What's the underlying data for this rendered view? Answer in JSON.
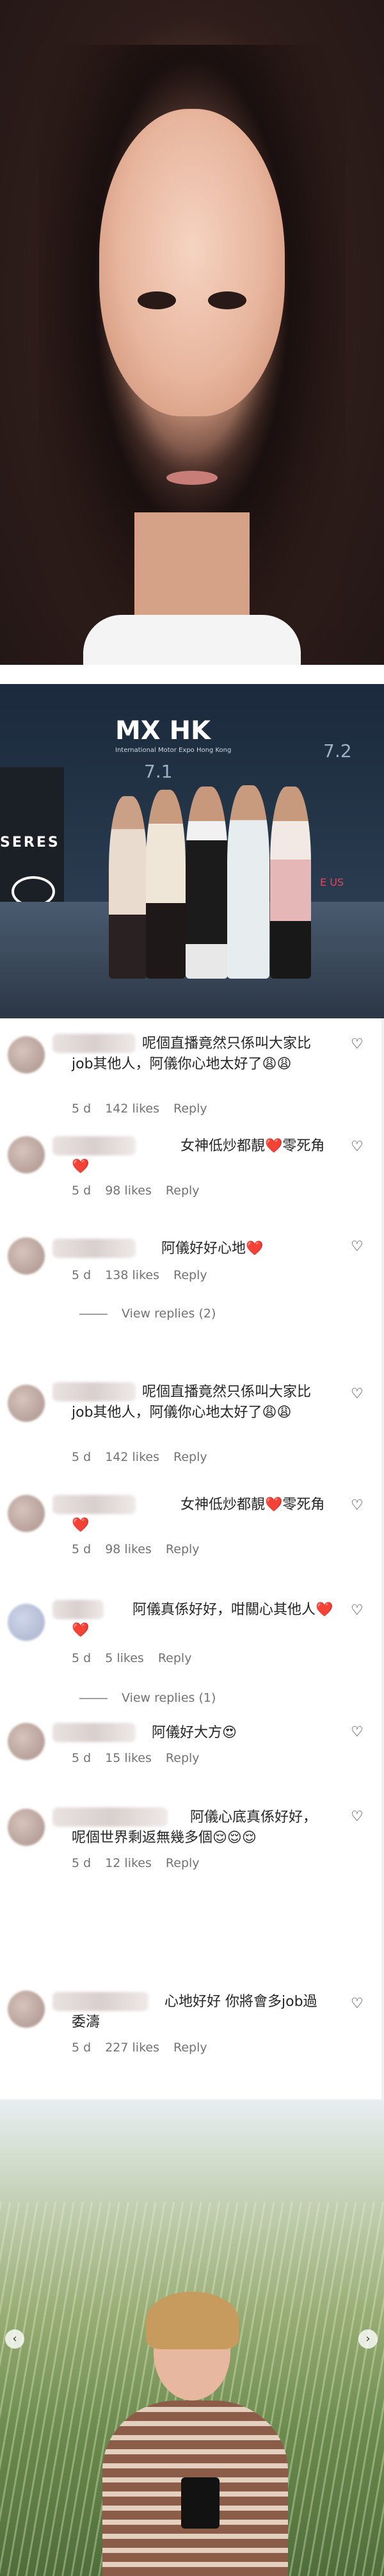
{
  "event_photo": {
    "logo": "MX HK",
    "logo_sub": "International Motor Expo Hong Kong",
    "booth_num_1": "7.1",
    "booth_num_2": "7.2",
    "brand_text": "SERES",
    "brand_tail": "E US"
  },
  "comments": [
    {
      "text": "呢個直播竟然只係叫大家比job其他人，阿儀你心地太好了😩😩",
      "time": "5 d",
      "likes": "142 likes",
      "reply": "Reply"
    },
    {
      "text": "女神低炒都靚❤️零死角❤️",
      "time": "5 d",
      "likes": "98 likes",
      "reply": "Reply"
    },
    {
      "text": "阿儀好好心地❤️",
      "time": "5 d",
      "likes": "138 likes",
      "reply": "Reply",
      "view_replies": "View replies (2)"
    },
    {
      "text": "呢個直播竟然只係叫大家比job其他人，阿儀你心地太好了😩😩",
      "time": "5 d",
      "likes": "142 likes",
      "reply": "Reply"
    },
    {
      "text": "女神低炒都靚❤️零死角❤️",
      "time": "5 d",
      "likes": "98 likes",
      "reply": "Reply"
    },
    {
      "text": "阿儀真係好好，咁關心其他人❤️❤️",
      "time": "5 d",
      "likes": "5 likes",
      "reply": "Reply",
      "view_replies": "View replies (1)"
    },
    {
      "text": "阿儀好大方😍",
      "time": "5 d",
      "likes": "15 likes",
      "reply": "Reply"
    },
    {
      "text": "阿儀心底真係好好，呢個世界剩返無幾多個😌😌😌",
      "time": "5 d",
      "likes": "12 likes",
      "reply": "Reply"
    },
    {
      "text": "心地好好 你將會多job過委濤",
      "time": "5 d",
      "likes": "227 likes",
      "reply": "Reply"
    }
  ],
  "icons": {
    "heart": "♡",
    "prev": "‹",
    "next": "›"
  }
}
